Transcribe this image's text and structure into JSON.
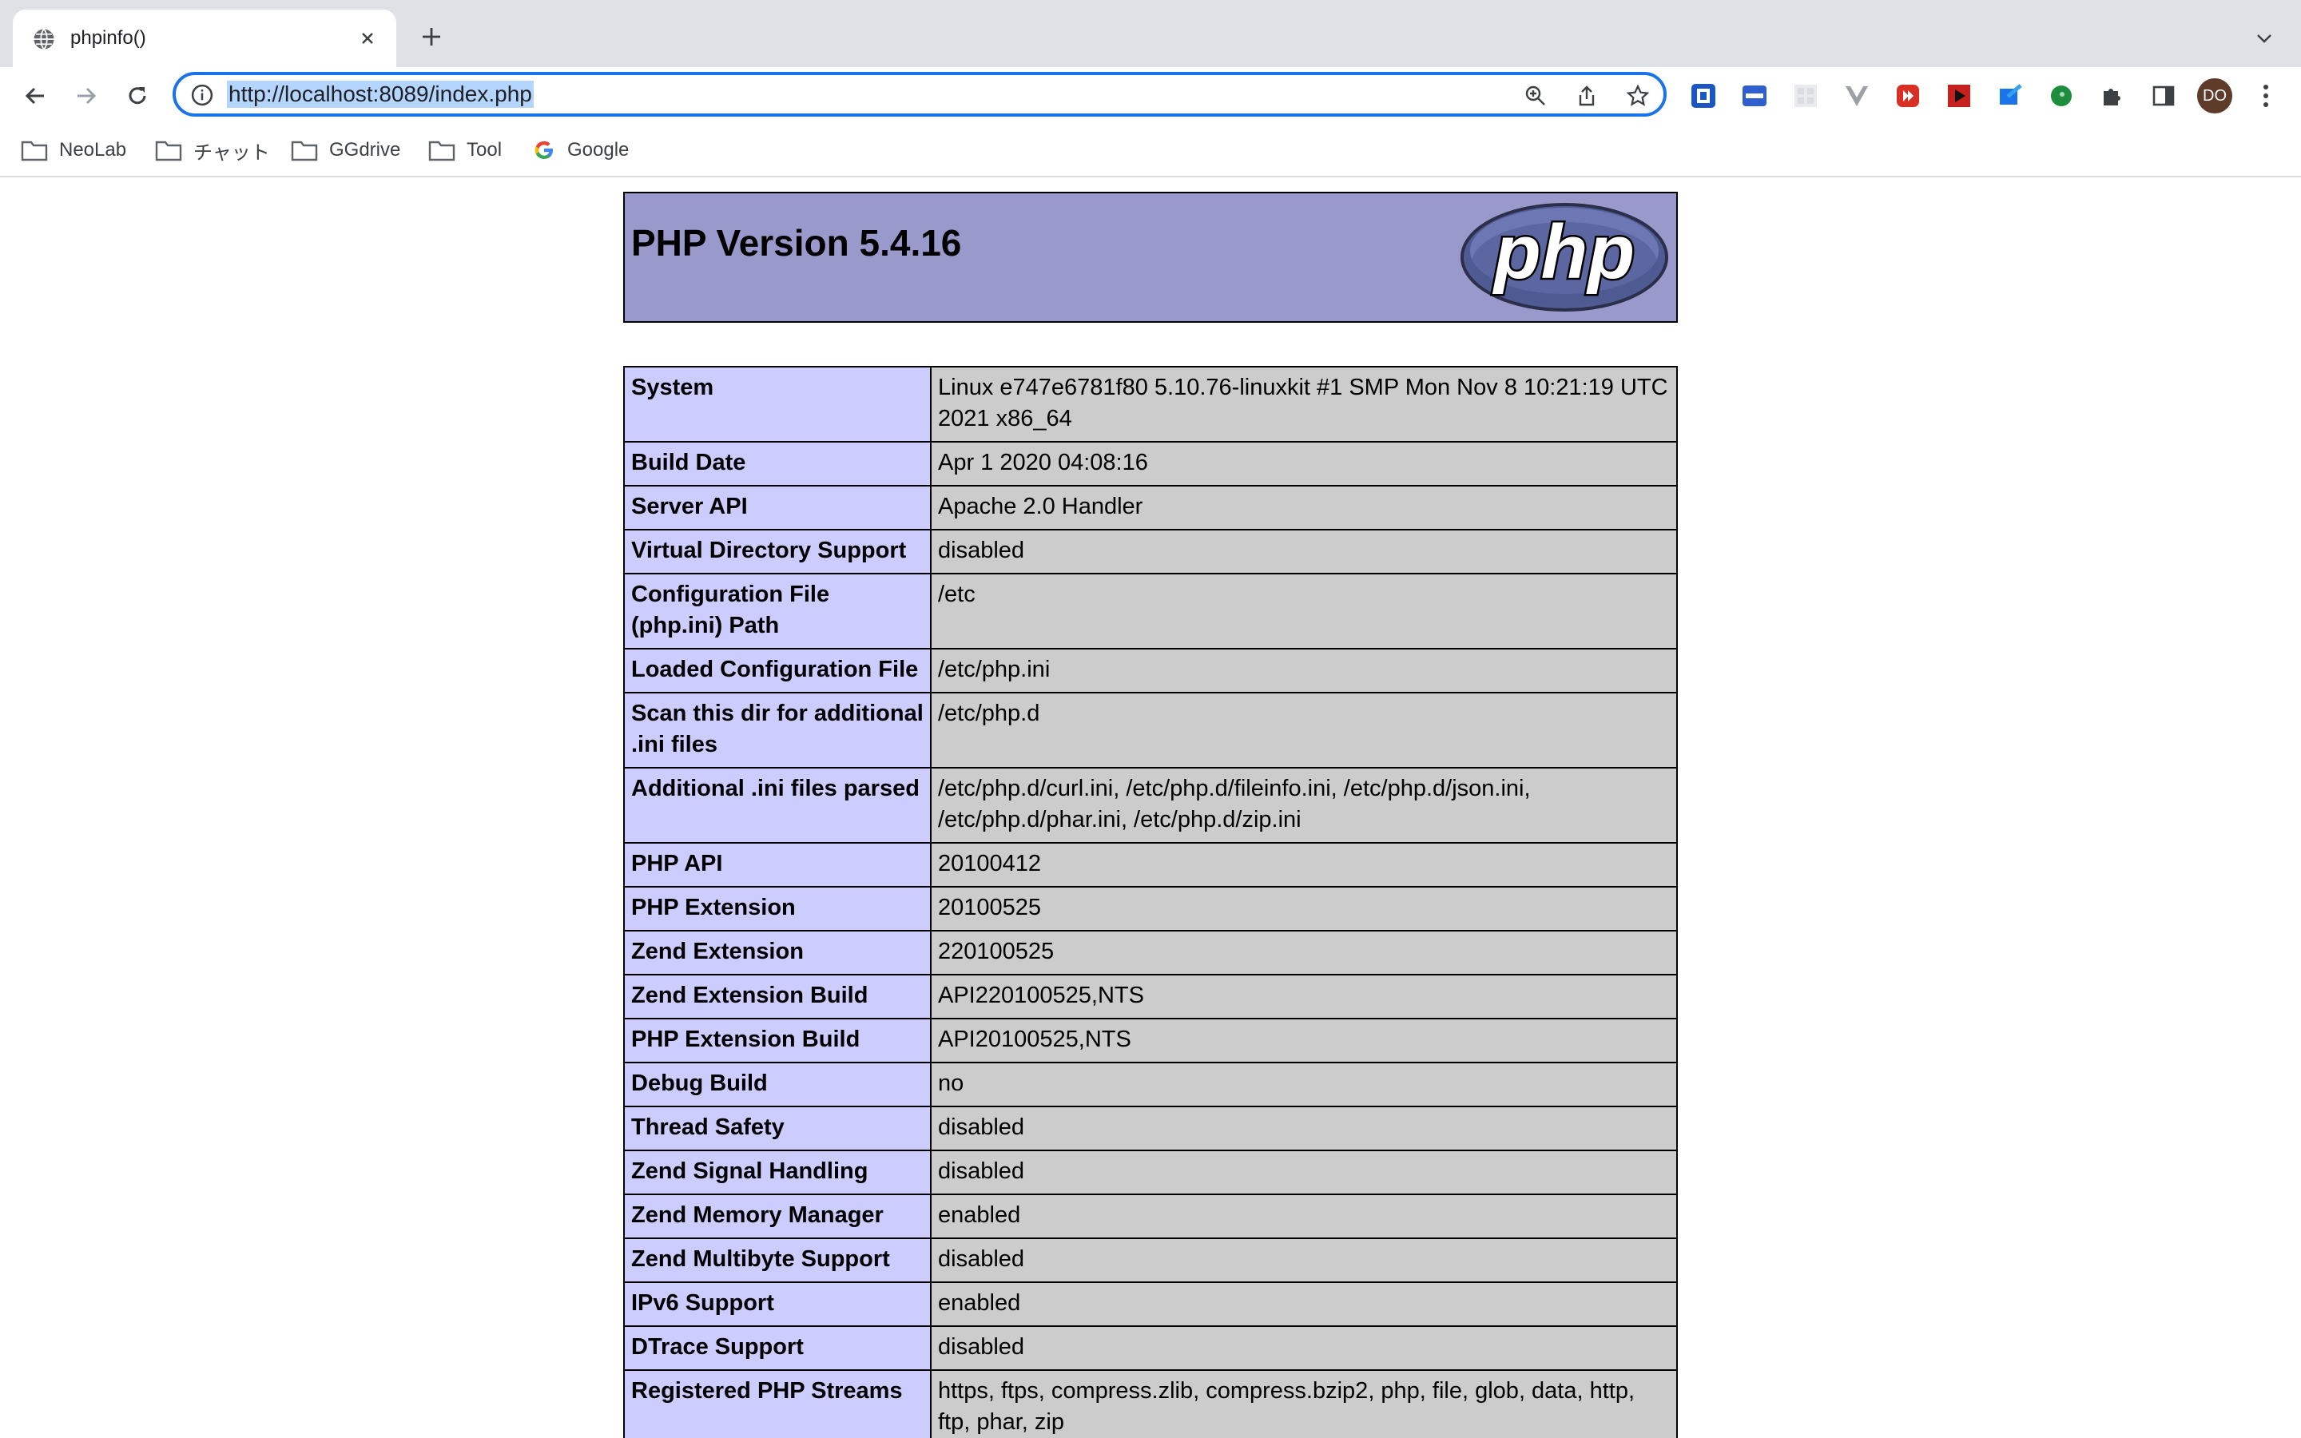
{
  "browser": {
    "tab_title": "phpinfo()",
    "url": "http://localhost:8089/index.php",
    "profile_initials": "DO",
    "bookmarks": [
      {
        "label": "NeoLab",
        "icon": "folder-icon"
      },
      {
        "label": "チャット",
        "icon": "folder-icon"
      },
      {
        "label": "GGdrive",
        "icon": "folder-icon"
      },
      {
        "label": "Tool",
        "icon": "folder-icon"
      },
      {
        "label": "Google",
        "icon": "google-icon"
      }
    ]
  },
  "page": {
    "title": "PHP Version 5.4.16",
    "logo_text": "php",
    "rows": [
      {
        "key": "System",
        "value": "Linux e747e6781f80 5.10.76-linuxkit #1 SMP Mon Nov 8 10:21:19 UTC 2021 x86_64"
      },
      {
        "key": "Build Date",
        "value": "Apr 1 2020 04:08:16"
      },
      {
        "key": "Server API",
        "value": "Apache 2.0 Handler"
      },
      {
        "key": "Virtual Directory Support",
        "value": "disabled"
      },
      {
        "key": "Configuration File (php.ini) Path",
        "value": "/etc"
      },
      {
        "key": "Loaded Configuration File",
        "value": "/etc/php.ini"
      },
      {
        "key": "Scan this dir for additional .ini files",
        "value": "/etc/php.d"
      },
      {
        "key": "Additional .ini files parsed",
        "value": "/etc/php.d/curl.ini, /etc/php.d/fileinfo.ini, /etc/php.d/json.ini, /etc/php.d/phar.ini, /etc/php.d/zip.ini"
      },
      {
        "key": "PHP API",
        "value": "20100412"
      },
      {
        "key": "PHP Extension",
        "value": "20100525"
      },
      {
        "key": "Zend Extension",
        "value": "220100525"
      },
      {
        "key": "Zend Extension Build",
        "value": "API220100525,NTS"
      },
      {
        "key": "PHP Extension Build",
        "value": "API20100525,NTS"
      },
      {
        "key": "Debug Build",
        "value": "no"
      },
      {
        "key": "Thread Safety",
        "value": "disabled"
      },
      {
        "key": "Zend Signal Handling",
        "value": "disabled"
      },
      {
        "key": "Zend Memory Manager",
        "value": "enabled"
      },
      {
        "key": "Zend Multibyte Support",
        "value": "disabled"
      },
      {
        "key": "IPv6 Support",
        "value": "enabled"
      },
      {
        "key": "DTrace Support",
        "value": "disabled"
      },
      {
        "key": "Registered PHP Streams",
        "value": "https, ftps, compress.zlib, compress.bzip2, php, file, glob, data, http, ftp, phar, zip"
      }
    ]
  },
  "colors": {
    "header_bg": "#9999cc",
    "key_bg": "#ccccff",
    "value_bg": "#cccccc",
    "omnibox_focus": "#1a73e8"
  }
}
